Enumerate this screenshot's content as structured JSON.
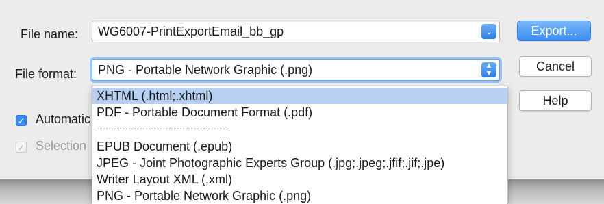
{
  "file_name": {
    "label": "File name:",
    "value": "WG6007-PrintExportEmail_bb_gp"
  },
  "file_format": {
    "label": "File format:",
    "value": "PNG - Portable Network Graphic (.png)"
  },
  "buttons": {
    "export": "Export...",
    "cancel": "Cancel",
    "help": "Help"
  },
  "options": {
    "automatic": {
      "label": "Automatic",
      "checked": true
    },
    "selection": {
      "label": "Selection",
      "checked": true,
      "disabled": true
    }
  },
  "format_list": [
    "XHTML (.html;.xhtml)",
    "PDF - Portable Document Format (.pdf)",
    "----------------------------------------------",
    "EPUB Document (.epub)",
    "JPEG - Joint Photographic Experts Group (.jpg;.jpeg;.jfif;.jif;.jpe)",
    "Writer Layout XML (.xml)",
    "PNG - Portable Network Graphic (.png)"
  ],
  "selected_format_index": 0,
  "icons": {
    "dropdown_chevron": "chevron-down-icon",
    "updown_chevron": "updown-chevron-icon",
    "checkmark": "checkmark-icon"
  }
}
